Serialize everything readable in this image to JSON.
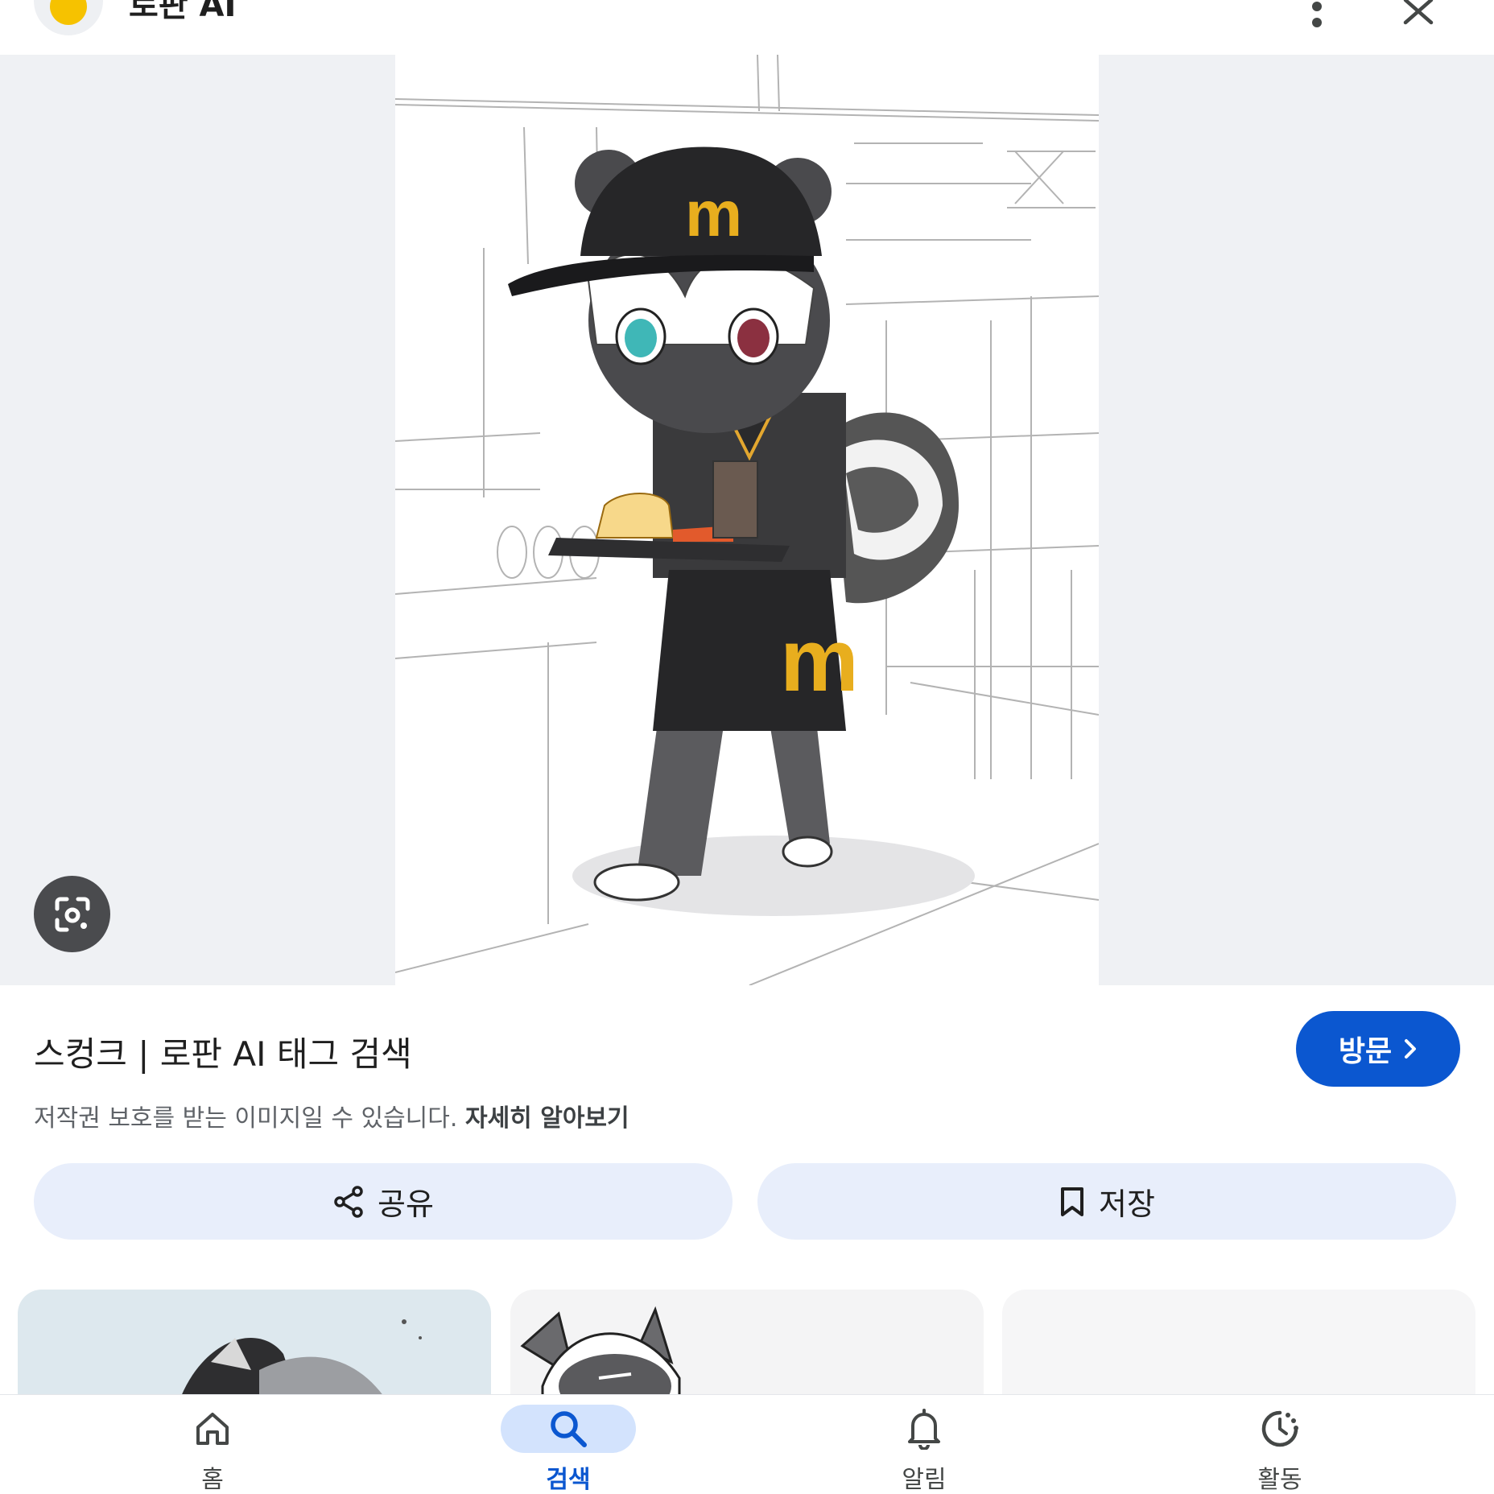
{
  "header": {
    "site_name": "로판 AI",
    "more_icon": "more-vert-icon",
    "close_icon": "close-icon"
  },
  "viewer": {
    "image_description": "skunk character in McDonald's uniform carrying a tray",
    "lens_icon": "google-lens-icon"
  },
  "result": {
    "title": "스컹크 | 로판 AI 태그 검색",
    "visit_label": "방문",
    "copyright_text": "저작권 보호를 받는 이미지일 수 있습니다.",
    "learn_more": "자세히 알아보기"
  },
  "actions": {
    "share_label": "공유",
    "save_label": "저장"
  },
  "bottom_nav": {
    "items": [
      {
        "label": "홈",
        "icon": "home-icon"
      },
      {
        "label": "검색",
        "icon": "search-icon",
        "active": true
      },
      {
        "label": "알림",
        "icon": "bell-icon"
      },
      {
        "label": "활동",
        "icon": "activity-icon"
      }
    ]
  },
  "colors": {
    "accent": "#0b57d0",
    "pill": "#e8eefb",
    "viewer_bg": "#eff1f4",
    "active_nav": "#d3e3fd"
  }
}
